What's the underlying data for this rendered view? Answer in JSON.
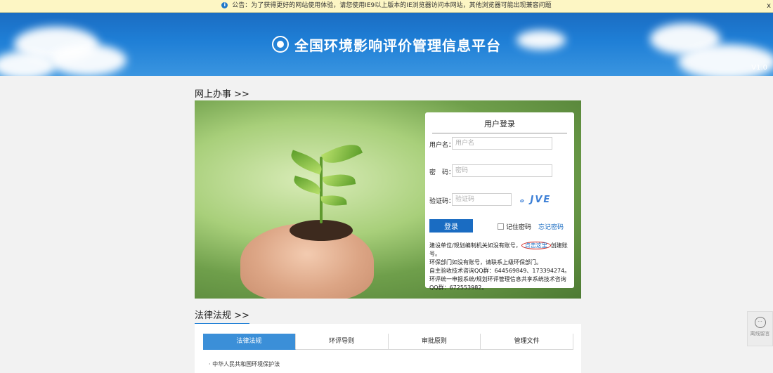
{
  "notice": {
    "icon": "info-icon",
    "text": "公告：为了获得更好的网站使用体验，请您使用IE9以上版本的IE浏览器访问本网站，其他浏览器可能出现兼容问题",
    "close": "x"
  },
  "banner": {
    "title": "全国环境影响评价管理信息平台",
    "version": "V1.0"
  },
  "sections": {
    "online": "网上办事 >>",
    "law": "法律法规 >>"
  },
  "login": {
    "title": "用户登录",
    "username_label": "用户名：",
    "username_placeholder": "用户名",
    "password_label": "密　码：",
    "password_placeholder": "密码",
    "captcha_label": "验证码：",
    "captcha_placeholder": "验证码",
    "captcha_text": "ₒ JVE",
    "submit": "登录",
    "remember": "记住密码",
    "forgot": "忘记密码",
    "info_prefix": "建设单位/规划编制机关如没有账号，",
    "info_link": "点击这里",
    "info_suffix": "创建账号。",
    "info_line2": "环保部门如没有账号，请联系上级环保部门。",
    "info_line3": "自主验收技术咨询QQ群：644569849、173394274。",
    "info_line4": "环评统一申报系统/规划环评管理信息共享系统技术咨询QQ群：672553982。"
  },
  "tabs": [
    "法律法规",
    "环评导则",
    "审批原则",
    "管理文件"
  ],
  "law_items": [
    "中华人民共和国环境保护法"
  ],
  "float_button": {
    "icon": "chat-icon",
    "label": "离线留言"
  },
  "colors": {
    "brand": "#1a6cc2",
    "tab_active": "#3b8fd8",
    "highlight_circle": "#d0201b"
  }
}
